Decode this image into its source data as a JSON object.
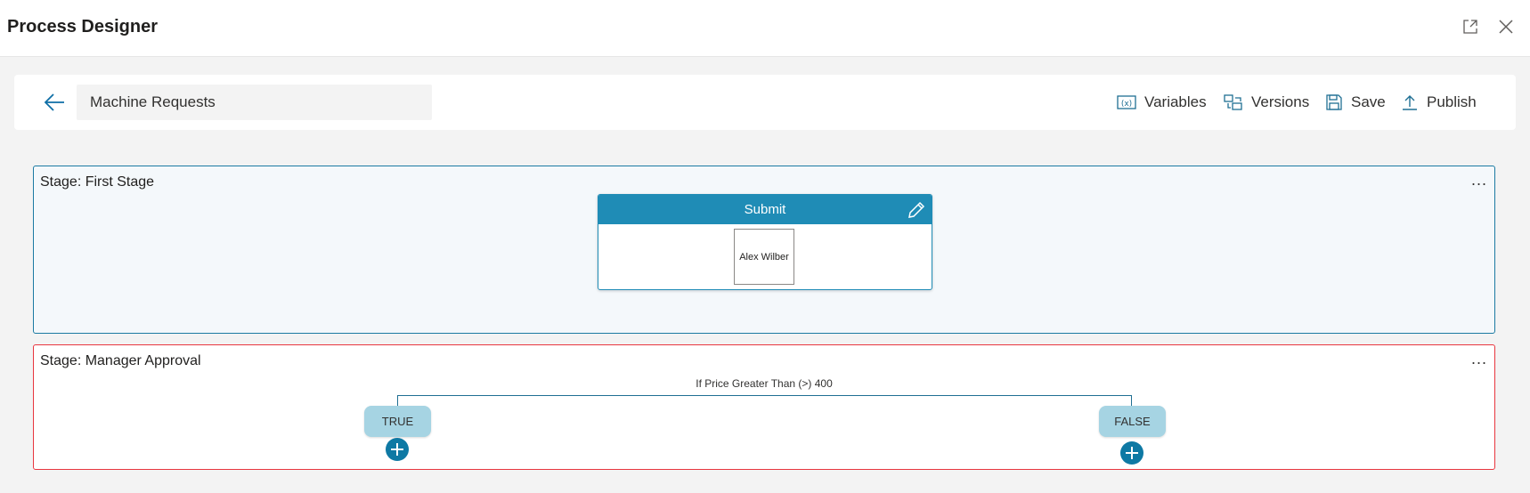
{
  "app": {
    "title": "Process Designer",
    "window_buttons": [
      {
        "name": "expand",
        "icon": "expand-icon"
      },
      {
        "name": "close",
        "icon": "close-icon"
      }
    ]
  },
  "toolbar": {
    "back_icon": "arrow-left-icon",
    "process_name": "Machine Requests",
    "buttons": [
      {
        "label": "Variables",
        "icon": "variables-icon"
      },
      {
        "label": "Versions",
        "icon": "versions-icon"
      },
      {
        "label": "Save",
        "icon": "save-icon"
      },
      {
        "label": "Publish",
        "icon": "upload-icon"
      }
    ]
  },
  "stages": [
    {
      "label": "Stage: First Stage",
      "more": "...",
      "border_color": "#1b7aa2",
      "step": {
        "title": "Submit",
        "edit_icon": "pencil-icon",
        "assignee": "Alex Wilber"
      }
    },
    {
      "label": "Stage: Manager Approval",
      "more": "...",
      "border_color": "#e8363f",
      "condition": {
        "label": "If Price Greater Than (>) 400",
        "true_label": "TRUE",
        "false_label": "FALSE",
        "add_icon": "plus-icon"
      }
    }
  ],
  "colors": {
    "accent": "#1f8cb6",
    "branch_pill": "#a6d4e3",
    "add_button": "#0e79a4",
    "error_border": "#e8363f"
  }
}
